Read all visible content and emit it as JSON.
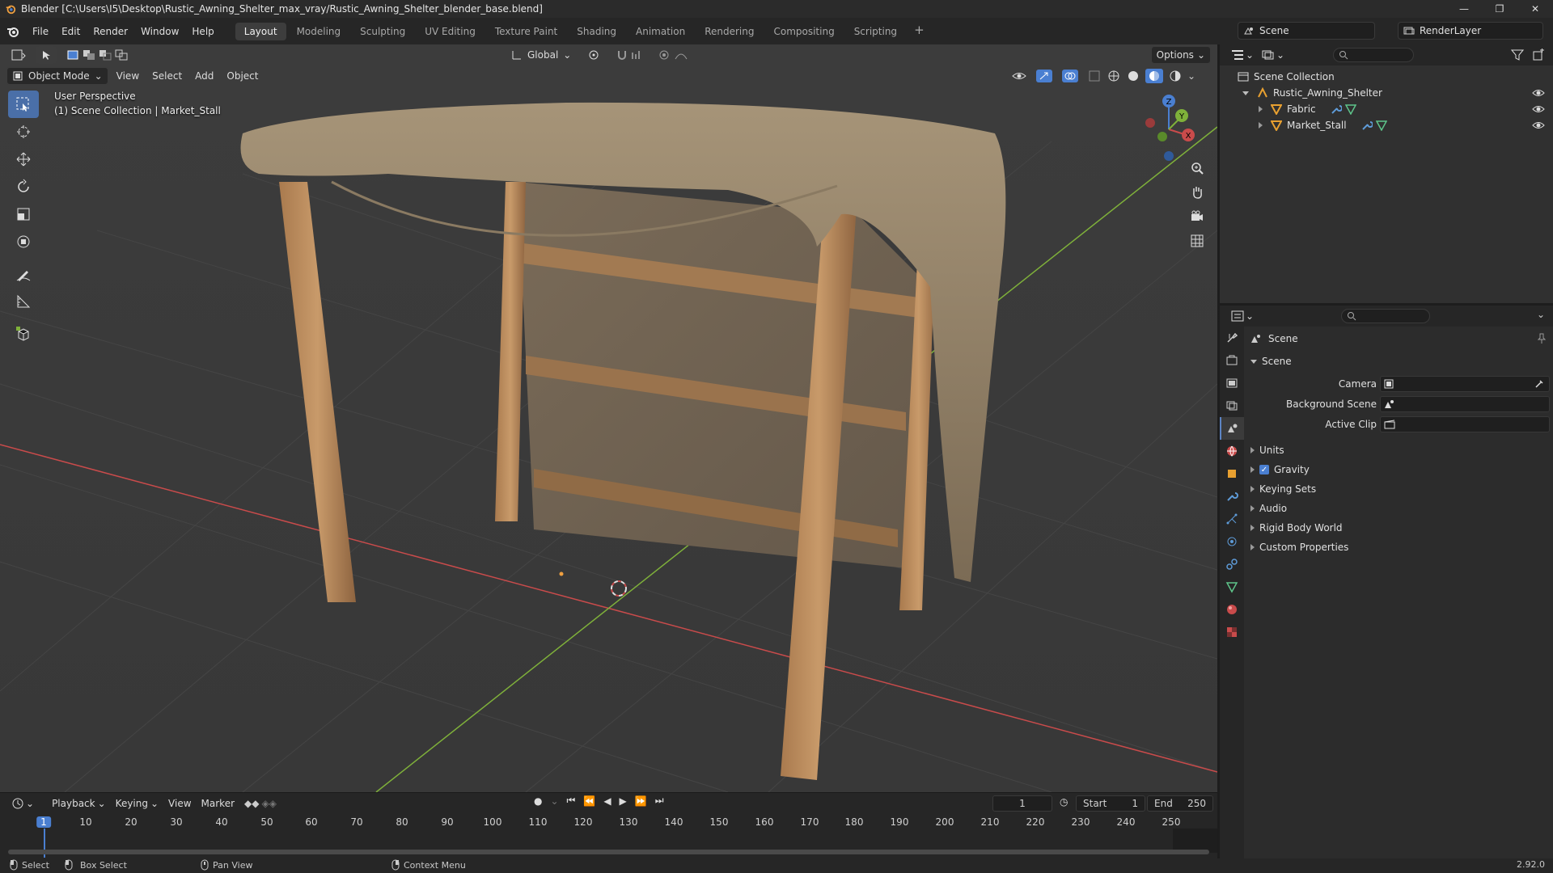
{
  "window": {
    "title": "Blender [C:\\Users\\I5\\Desktop\\Rustic_Awning_Shelter_max_vray/Rustic_Awning_Shelter_blender_base.blend]",
    "controls": [
      "—",
      "❐",
      "✕"
    ]
  },
  "menu": [
    "File",
    "Edit",
    "Render",
    "Window",
    "Help"
  ],
  "workspaces": [
    "Layout",
    "Modeling",
    "Sculpting",
    "UV Editing",
    "Texture Paint",
    "Shading",
    "Animation",
    "Rendering",
    "Compositing",
    "Scripting"
  ],
  "active_workspace": "Layout",
  "scene_selector": "Scene",
  "view_layer": "RenderLayer",
  "viewport": {
    "mode": "Object Mode",
    "menus": [
      "View",
      "Select",
      "Add",
      "Object"
    ],
    "orientation": "Global",
    "options_label": "Options",
    "info_line1": "User Perspective",
    "info_line2": "(1) Scene Collection | Market_Stall",
    "axis_labels": {
      "x": "X",
      "y": "Y",
      "z": "Z"
    }
  },
  "timeline": {
    "menus": [
      "Playback",
      "Keying",
      "View",
      "Marker"
    ],
    "current_frame": "1",
    "start_label": "Start",
    "start": "1",
    "end_label": "End",
    "end": "250",
    "ruler": [
      "1",
      "10",
      "20",
      "30",
      "40",
      "50",
      "60",
      "70",
      "80",
      "90",
      "100",
      "110",
      "120",
      "130",
      "140",
      "150",
      "160",
      "170",
      "180",
      "190",
      "200",
      "210",
      "220",
      "230",
      "240",
      "250"
    ]
  },
  "statusbar": {
    "select": "Select",
    "box_select": "Box Select",
    "pan_view": "Pan View",
    "context_menu": "Context Menu",
    "version": "2.92.0"
  },
  "outliner": {
    "root": "Scene Collection",
    "collection": "Rustic_Awning_Shelter",
    "objects": [
      "Fabric",
      "Market_Stall"
    ]
  },
  "properties": {
    "context": "Scene",
    "panel_title": "Scene",
    "camera_label": "Camera",
    "background_scene_label": "Background Scene",
    "active_clip_label": "Active Clip",
    "subpanels": [
      "Units",
      "Gravity",
      "Keying Sets",
      "Audio",
      "Rigid Body World",
      "Custom Properties"
    ]
  },
  "colors": {
    "accent": "#4a7fd1",
    "x_axis": "#c94b4b",
    "y_axis": "#7fb13a",
    "z_axis": "#4a7fd1"
  }
}
